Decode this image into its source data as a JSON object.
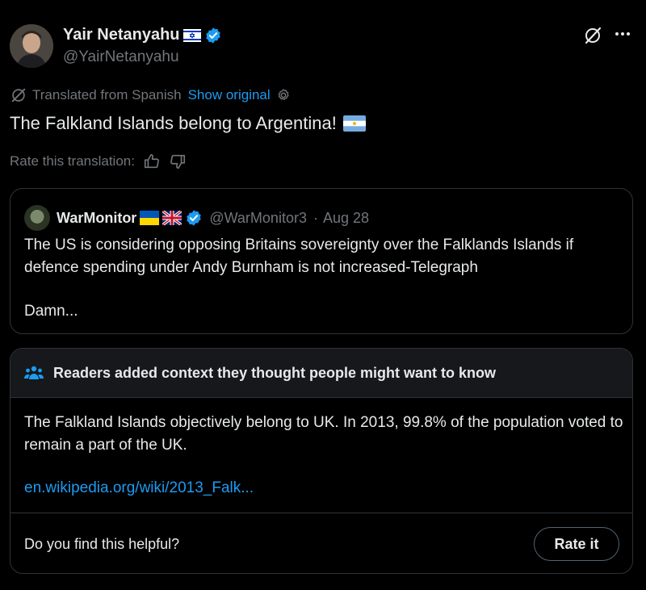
{
  "author": {
    "name": "Yair Netanyahu",
    "handle": "@YairNetanyahu",
    "flag_icon": "israel-flag-icon",
    "verified_icon": "verified-badge-icon"
  },
  "translation": {
    "label": "Translated from Spanish",
    "show_original": "Show original",
    "settings_icon": "gear-icon"
  },
  "post": {
    "text": "The Falkland Islands belong to Argentina!",
    "flag_icon": "argentina-flag-icon"
  },
  "rate_translation": {
    "label": "Rate this translation:"
  },
  "quote": {
    "name": "WarMonitor",
    "handle": "@WarMonitor3",
    "date": "Aug 28",
    "separator": "·",
    "text_1": "The US is considering opposing Britains sovereignty over the Falklands Islands if defence spending under Andy Burnham is not increased-Telegraph",
    "text_2": "Damn..."
  },
  "note": {
    "title": "Readers added context they thought people might want to know",
    "body": "The Falkland Islands objectively belong to UK. In 2013, 99.8% of the population voted to remain a part of the UK.",
    "link": "en.wikipedia.org/wiki/2013_Falk...",
    "helpful_question": "Do you find this helpful?",
    "rate_button": "Rate it"
  },
  "colors": {
    "background": "#000000",
    "text": "#e7e9ea",
    "muted": "#71767b",
    "accent": "#1d9bf0",
    "border": "#2f3336",
    "note_header": "#16181c"
  }
}
